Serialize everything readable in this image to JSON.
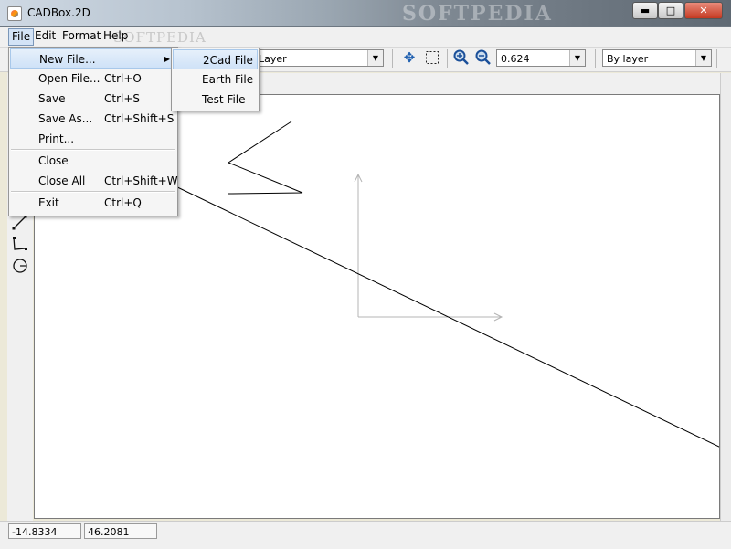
{
  "window": {
    "title": "CADBox.2D"
  },
  "menubar": {
    "file": "File",
    "edit": "Edit",
    "format": "Format",
    "help": "Help"
  },
  "toolbar": {
    "layer_combo": "Layer",
    "zoom_value": "0.624",
    "linetype_combo": "By layer"
  },
  "file_menu": [
    {
      "label": "New File...",
      "shortcut": ""
    },
    {
      "label": "Open File...",
      "shortcut": "Ctrl+O"
    },
    {
      "label": "Save",
      "shortcut": "Ctrl+S"
    },
    {
      "label": "Save As...",
      "shortcut": "Ctrl+Shift+S"
    },
    {
      "label": "Print...",
      "shortcut": ""
    },
    {
      "label": "Close",
      "shortcut": ""
    },
    {
      "label": "Close All",
      "shortcut": "Ctrl+Shift+W"
    },
    {
      "label": "Exit",
      "shortcut": "Ctrl+Q"
    }
  ],
  "new_file_submenu": [
    "2Cad File",
    "Earth File",
    "Test File"
  ],
  "status": {
    "x": "-14.8334",
    "y": "46.2081"
  },
  "colors": {
    "menu_highlight": "#cfe2f7",
    "canvas": "#ffffff",
    "axis": "#b4b4b4"
  },
  "icons": [
    "app-icon",
    "minimize-icon",
    "maximize-icon",
    "close-icon",
    "pan-icon",
    "select-rect-icon",
    "zoom-in-icon",
    "zoom-out-icon",
    "line-tool-icon",
    "polyline-tool-icon",
    "circle-tool-icon",
    "submenu-arrow-icon"
  ]
}
